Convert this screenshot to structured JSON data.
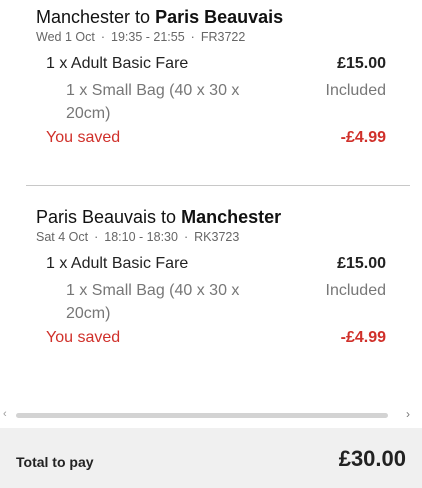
{
  "flights": [
    {
      "route_prefix": "Manchester to ",
      "destination": "Paris Beauvais",
      "date": "Wed 1 Oct",
      "time": "19:35 - 21:55",
      "flight_no": "FR3722",
      "fare_label": "1 x Adult Basic Fare",
      "fare_price": "£15.00",
      "bag_label": "1 x Small Bag (40 x 30 x 20cm)",
      "bag_status": "Included",
      "saved_label": "You saved",
      "saved_amount": "-£4.99"
    },
    {
      "route_prefix": "Paris Beauvais to ",
      "destination": "Manchester",
      "date": "Sat 4 Oct",
      "time": "18:10 - 18:30",
      "flight_no": "RK3723",
      "fare_label": "1 x Adult Basic Fare",
      "fare_price": "£15.00",
      "bag_label": "1 x Small Bag (40 x 30 x 20cm)",
      "bag_status": "Included",
      "saved_label": "You saved",
      "saved_amount": "-£4.99"
    }
  ],
  "separator": "·",
  "scrollbar": {
    "left_icon": "chevron-left-icon",
    "right_icon": "chevron-right-icon"
  },
  "total": {
    "label": "Total to pay",
    "value": "£30.00"
  },
  "colors": {
    "saved": "#d0302a",
    "total_bg": "#f0f0f0"
  }
}
